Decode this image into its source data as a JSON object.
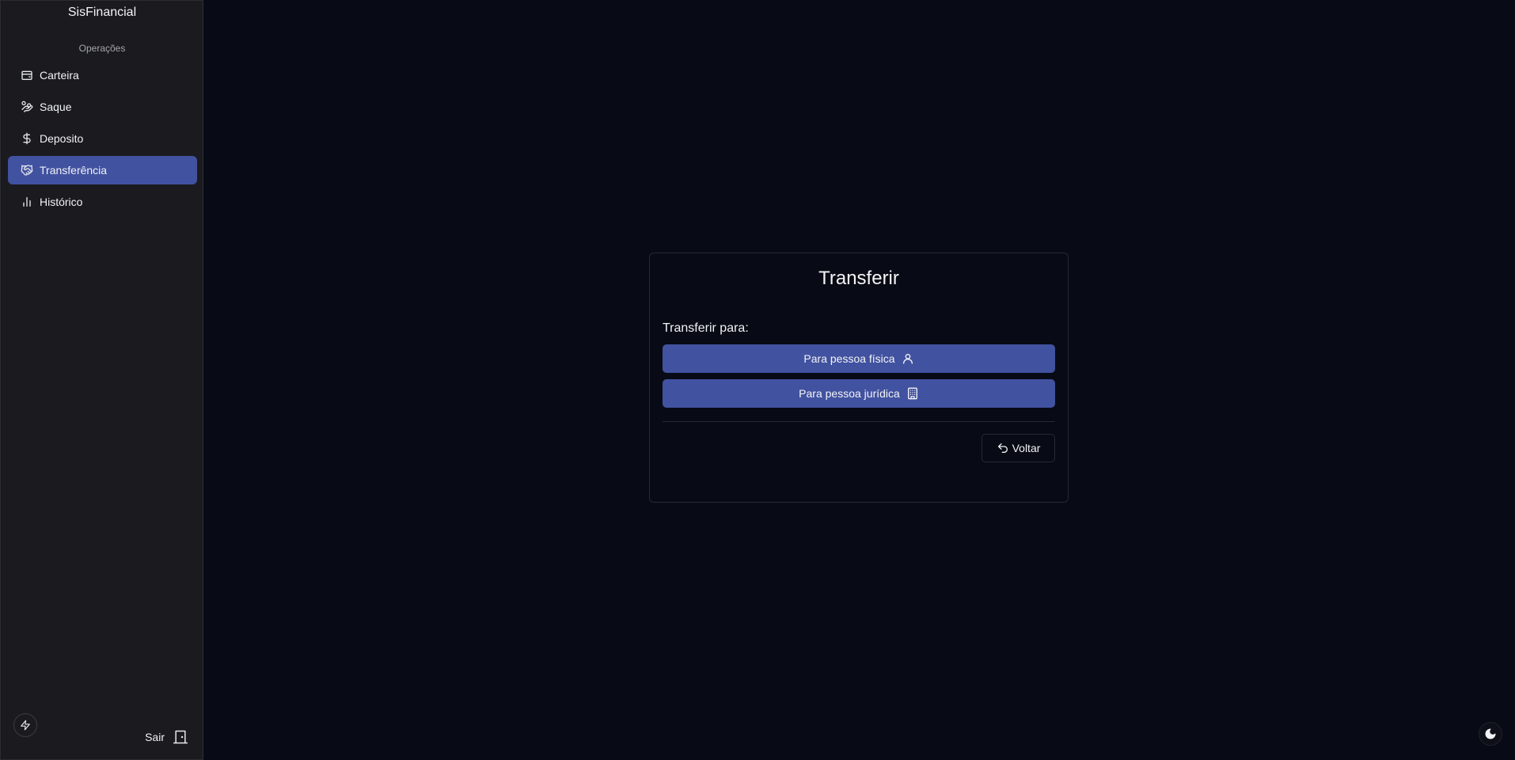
{
  "sidebar": {
    "brand": "SisFinancial",
    "section_label": "Operações",
    "items": [
      {
        "label": "Carteira",
        "icon": "wallet-icon",
        "active": false
      },
      {
        "label": "Saque",
        "icon": "hand-coins-icon",
        "active": false
      },
      {
        "label": "Deposito",
        "icon": "dollar-sign-icon",
        "active": false
      },
      {
        "label": "Transferência",
        "icon": "handshake-icon",
        "active": true
      },
      {
        "label": "Histórico",
        "icon": "bar-chart-icon",
        "active": false
      }
    ],
    "logout_label": "Sair"
  },
  "card": {
    "title": "Transferir",
    "label": "Transferir para:",
    "option_fisica": "Para pessoa física",
    "option_juridica": "Para pessoa jurídica",
    "back_label": "Voltar"
  },
  "colors": {
    "accent": "#4152a0",
    "background": "#080b15",
    "sidebar": "#1b1b1f"
  }
}
